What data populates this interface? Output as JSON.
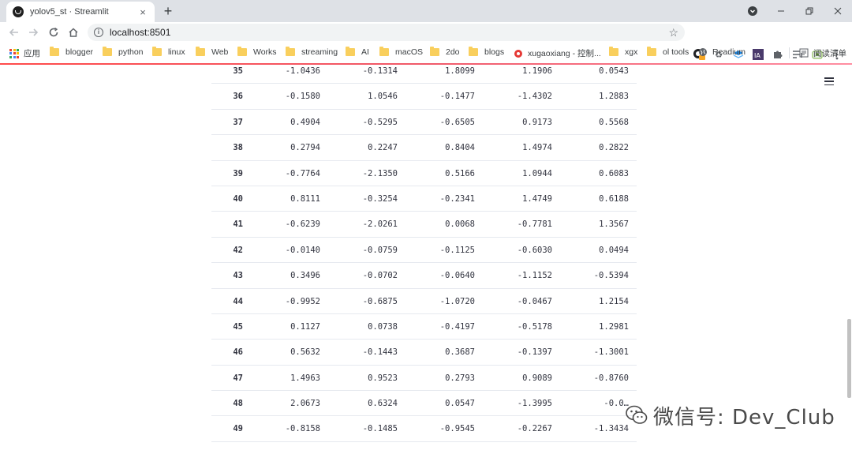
{
  "browser": {
    "tab_title": "yolov5_st · Streamlit",
    "tab_close": "×",
    "new_tab": "+",
    "url": "localhost:8501"
  },
  "bookmarks": [
    {
      "label": "应用",
      "type": "apps"
    },
    {
      "label": "blogger",
      "type": "folder"
    },
    {
      "label": "python",
      "type": "folder"
    },
    {
      "label": "linux",
      "type": "folder"
    },
    {
      "label": "Web",
      "type": "folder"
    },
    {
      "label": "Works",
      "type": "folder"
    },
    {
      "label": "streaming",
      "type": "folder"
    },
    {
      "label": "AI",
      "type": "folder"
    },
    {
      "label": "macOS",
      "type": "folder"
    },
    {
      "label": "2do",
      "type": "folder"
    },
    {
      "label": "blogs",
      "type": "folder"
    },
    {
      "label": "xugaoxiang - 控制...",
      "type": "site"
    },
    {
      "label": "xgx",
      "type": "folder"
    },
    {
      "label": "ol tools",
      "type": "folder"
    },
    {
      "label": "Readium",
      "type": "site"
    },
    {
      "label": "阅读清单",
      "type": "reading-list"
    }
  ],
  "table": {
    "rows": [
      {
        "index": "35",
        "values": [
          "-1.0436",
          "-0.1314",
          "1.8099",
          "1.1906",
          "0.0543"
        ]
      },
      {
        "index": "36",
        "values": [
          "-0.1580",
          "1.0546",
          "-0.1477",
          "-1.4302",
          "1.2883"
        ]
      },
      {
        "index": "37",
        "values": [
          "0.4904",
          "-0.5295",
          "-0.6505",
          "0.9173",
          "0.5568"
        ]
      },
      {
        "index": "38",
        "values": [
          "0.2794",
          "0.2247",
          "0.8404",
          "1.4974",
          "0.2822"
        ]
      },
      {
        "index": "39",
        "values": [
          "-0.7764",
          "-2.1350",
          "0.5166",
          "1.0944",
          "0.6083"
        ]
      },
      {
        "index": "40",
        "values": [
          "0.8111",
          "-0.3254",
          "-0.2341",
          "1.4749",
          "0.6188"
        ]
      },
      {
        "index": "41",
        "values": [
          "-0.6239",
          "-2.0261",
          "0.0068",
          "-0.7781",
          "1.3567"
        ]
      },
      {
        "index": "42",
        "values": [
          "-0.0140",
          "-0.0759",
          "-0.1125",
          "-0.6030",
          "0.0494"
        ]
      },
      {
        "index": "43",
        "values": [
          "0.3496",
          "-0.0702",
          "-0.0640",
          "-1.1152",
          "-0.5394"
        ]
      },
      {
        "index": "44",
        "values": [
          "-0.9952",
          "-0.6875",
          "-1.0720",
          "-0.0467",
          "1.2154"
        ]
      },
      {
        "index": "45",
        "values": [
          "0.1127",
          "0.0738",
          "-0.4197",
          "-0.5178",
          "1.2981"
        ]
      },
      {
        "index": "46",
        "values": [
          "0.5632",
          "-0.1443",
          "0.3687",
          "-0.1397",
          "-1.3001"
        ]
      },
      {
        "index": "47",
        "values": [
          "1.4963",
          "0.9523",
          "0.2793",
          "0.9089",
          "-0.8760"
        ]
      },
      {
        "index": "48",
        "values": [
          "2.0673",
          "0.6324",
          "0.0547",
          "-1.3995",
          "-0.0…"
        ]
      },
      {
        "index": "49",
        "values": [
          "-0.8158",
          "-0.1485",
          "-0.9545",
          "-0.2267",
          "-1.3434"
        ]
      }
    ]
  },
  "watermark": {
    "text": "微信号: Dev_Club"
  },
  "colors": {
    "accent_gradient_start": "#ff4b4b",
    "accent_gradient_end": "#ff8ea2",
    "text": "#31333f",
    "row_border": "#e6e9ef"
  }
}
